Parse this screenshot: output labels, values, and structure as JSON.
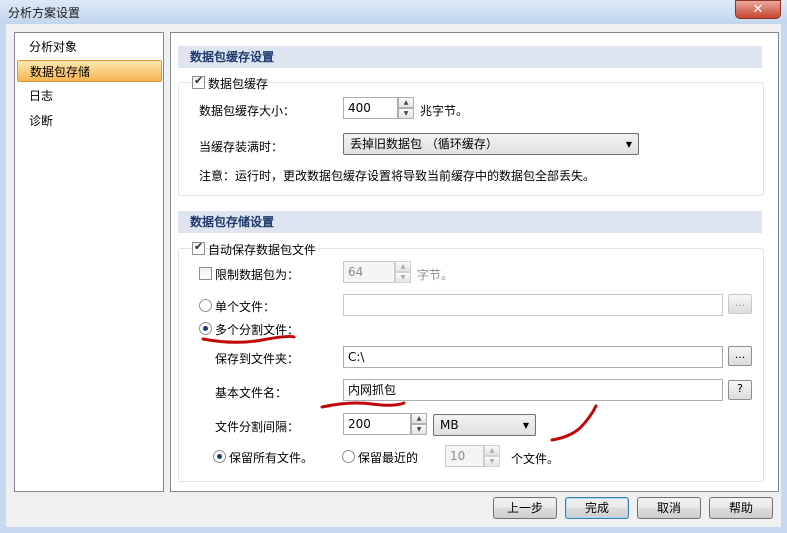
{
  "window": {
    "title": "分析方案设置",
    "close_glyph": "✕"
  },
  "sidebar": {
    "items": [
      {
        "label": "分析对象"
      },
      {
        "label": "数据包存储"
      },
      {
        "label": "日志"
      },
      {
        "label": "诊断"
      }
    ],
    "selected": "数据包存储"
  },
  "cache": {
    "header": "数据包缓存设置",
    "enable_label": "数据包缓存",
    "enable_checked": true,
    "size_label": "数据包缓存大小：",
    "size_value": "400",
    "size_unit": "兆字节。",
    "when_full_label": "当缓存装满时：",
    "when_full_value": "丢掉旧数据包 （循环缓存）",
    "note": "注意：运行时，更改数据包缓存设置将导致当前缓存中的数据包全部丢失。"
  },
  "storage": {
    "header": "数据包存储设置",
    "autosave_label": "自动保存数据包文件",
    "autosave_checked": true,
    "limit_label": "限制数据包为：",
    "limit_checked": false,
    "limit_value": "64",
    "limit_unit": "字节。",
    "single_label": "单个文件：",
    "single_selected": false,
    "single_path": "",
    "multi_label": "多个分割文件：",
    "multi_selected": true,
    "folder_label": "保存到文件夹：",
    "folder_value": "C:\\",
    "basename_label": "基本文件名：",
    "basename_value": "内网抓包",
    "interval_label": "文件分割间隔：",
    "interval_value": "200",
    "interval_unit": "MB",
    "keep_all_label": "保留所有文件。",
    "keep_all_selected": true,
    "keep_recent_label": "保留最近的",
    "keep_recent_selected": false,
    "keep_recent_value": "10",
    "keep_recent_unit": "个文件。",
    "browse_glyph": "...",
    "help_glyph": "?"
  },
  "buttons": {
    "back": "上一步",
    "finish": "完成",
    "cancel": "取消",
    "help": "帮助"
  },
  "annotation_color": "#c0080a"
}
